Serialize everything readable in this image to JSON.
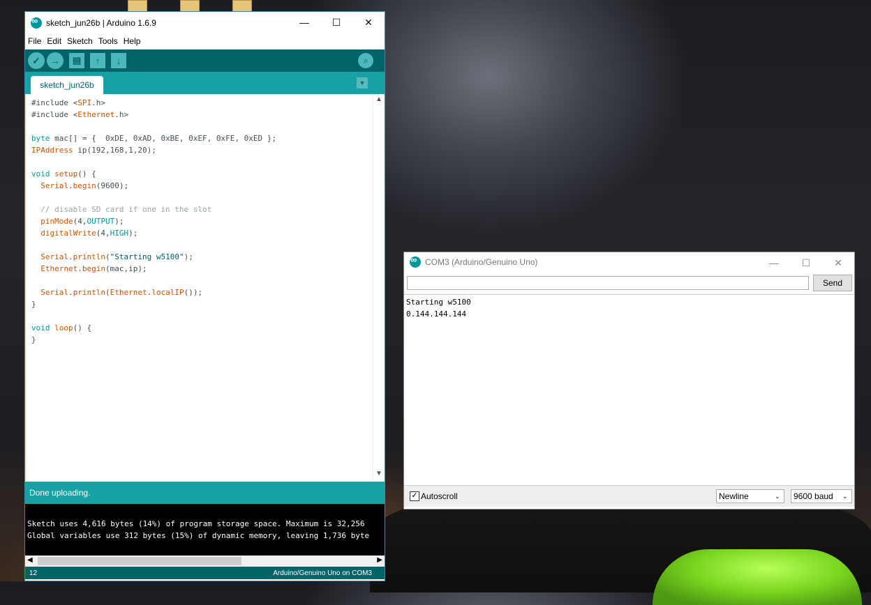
{
  "ide": {
    "title": "sketch_jun26b | Arduino 1.6.9",
    "window_controls": {
      "minimize": "—",
      "maximize": "☐",
      "close": "✕"
    },
    "menu": [
      "File",
      "Edit",
      "Sketch",
      "Tools",
      "Help"
    ],
    "toolbar": {
      "verify_icon": "✓",
      "upload_icon": "→",
      "new_icon": "▤",
      "open_icon": "↑",
      "save_icon": "↓",
      "serial_icon": "⌕"
    },
    "tab_label": "sketch_jun26b",
    "tab_menu_icon": "▼",
    "status_message": "Done uploading.",
    "console_lines": [
      "Sketch uses 4,616 bytes (14%) of program storage space. Maximum is 32,256",
      "Global variables use 312 bytes (15%) of dynamic memory, leaving 1,736 byte"
    ],
    "line_number": "12",
    "board_port": "Arduino/Genuino Uno on COM3"
  },
  "serial": {
    "title": "COM3 (Arduino/Genuino Uno)",
    "input_value": "",
    "send_label": "Send",
    "output_lines": [
      "Starting w5100",
      "0.144.144.144"
    ],
    "autoscroll_label": "Autoscroll",
    "autoscroll_checked": "✓",
    "line_ending": "Newline",
    "baud": "9600 baud"
  }
}
